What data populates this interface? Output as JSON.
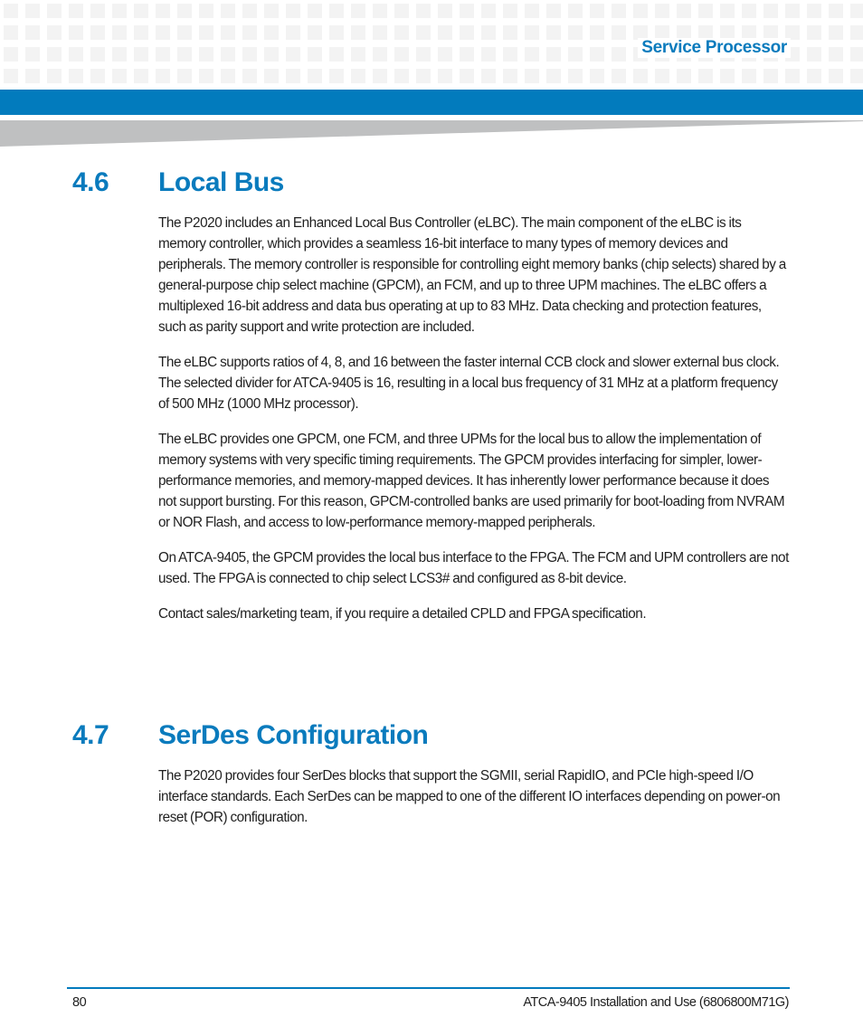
{
  "header": {
    "title": "Service Processor",
    "brand_color": "#027bbd"
  },
  "sections": [
    {
      "number": "4.6",
      "title": "Local Bus",
      "paragraphs": [
        "The P2020 includes an Enhanced Local Bus Controller (eLBC). The main component of the eLBC is its memory controller, which provides a seamless 16-bit interface to many types of memory devices and peripherals. The memory controller is responsible for controlling eight memory banks (chip selects) shared by a general-purpose chip select machine (GPCM), an FCM, and up to three UPM machines. The eLBC offers a multiplexed 16-bit address and data bus operating at up to 83 MHz. Data checking and protection features, such as parity support and write protection are included.",
        "The eLBC supports ratios of 4, 8, and 16 between the faster internal CCB clock and slower external bus clock. The selected divider for ATCA-9405 is 16, resulting in a local bus frequency of 31 MHz at a platform frequency of 500 MHz (1000 MHz processor).",
        "The eLBC provides one GPCM, one FCM, and three UPMs for the local bus to allow the implementation of memory systems with very specific timing requirements. The GPCM provides interfacing for simpler, lower-performance memories, and memory-mapped devices. It has inherently lower performance because it does not support bursting. For this reason, GPCM-controlled banks are used primarily for boot-loading from NVRAM or NOR Flash, and access to low-performance memory-mapped peripherals.",
        "On ATCA-9405, the GPCM provides the local bus interface to the FPGA. The FCM and UPM controllers are not used. The FPGA is connected to chip select LCS3# and configured as 8-bit device.",
        "Contact sales/marketing team, if you require a detailed CPLD and FPGA specification."
      ]
    },
    {
      "number": "4.7",
      "title": "SerDes Configuration",
      "paragraphs": [
        "The P2020 provides four SerDes blocks that support the SGMII, serial RapidIO, and PCIe high-speed I/O interface standards. Each SerDes can be mapped to one of the different IO interfaces depending on power-on reset (POR) configuration."
      ]
    }
  ],
  "footer": {
    "page_number": "80",
    "document": "ATCA-9405 Installation and Use (6806800M71G)"
  }
}
